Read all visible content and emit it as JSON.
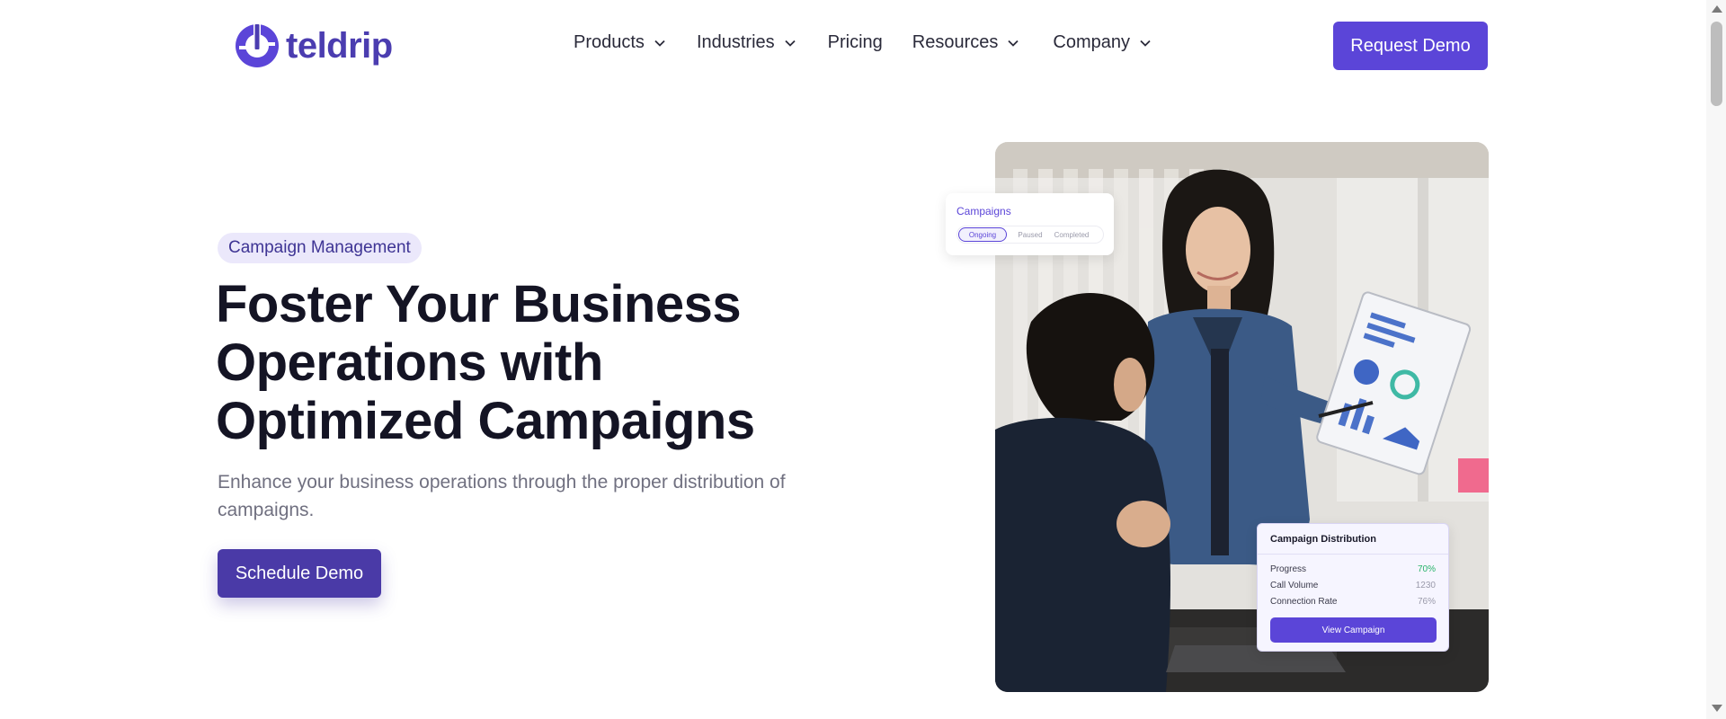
{
  "header": {
    "logo_text": "teldrip",
    "nav": [
      {
        "label": "Products",
        "has_dropdown": true
      },
      {
        "label": "Industries",
        "has_dropdown": true
      },
      {
        "label": "Pricing",
        "has_dropdown": false
      },
      {
        "label": "Resources",
        "has_dropdown": true
      },
      {
        "label": "Company",
        "has_dropdown": true
      }
    ],
    "cta_label": "Request Demo"
  },
  "hero": {
    "tag": "Campaign Management",
    "title_lines": [
      "Foster Your Business",
      "Operations with",
      "Optimized Campaigns"
    ],
    "subtitle": "Enhance your business operations through the proper distribution of campaigns.",
    "cta_label": "Schedule Demo"
  },
  "campaigns_card": {
    "title": "Campaigns",
    "tabs": [
      "Ongoing",
      "Paused",
      "Completed"
    ],
    "active_tab": "Ongoing"
  },
  "distribution_card": {
    "title": "Campaign Distribution",
    "stats": [
      {
        "label": "Progress",
        "value": "70%"
      },
      {
        "label": "Call Volume",
        "value": "1230"
      },
      {
        "label": "Connection Rate",
        "value": "76%"
      }
    ],
    "button_label": "View Campaign"
  },
  "colors": {
    "brand": "#5b45d8",
    "brand_dark": "#4a3aa7",
    "tag_bg": "#ebe8fb",
    "title": "#141424",
    "subtitle": "#707080",
    "positive": "#27b36a"
  },
  "icons": {
    "logo": "teldrip-logo-icon",
    "dropdown": "chevron-down-icon",
    "scroll_up": "arrow-up-icon",
    "scroll_down": "arrow-down-icon"
  }
}
